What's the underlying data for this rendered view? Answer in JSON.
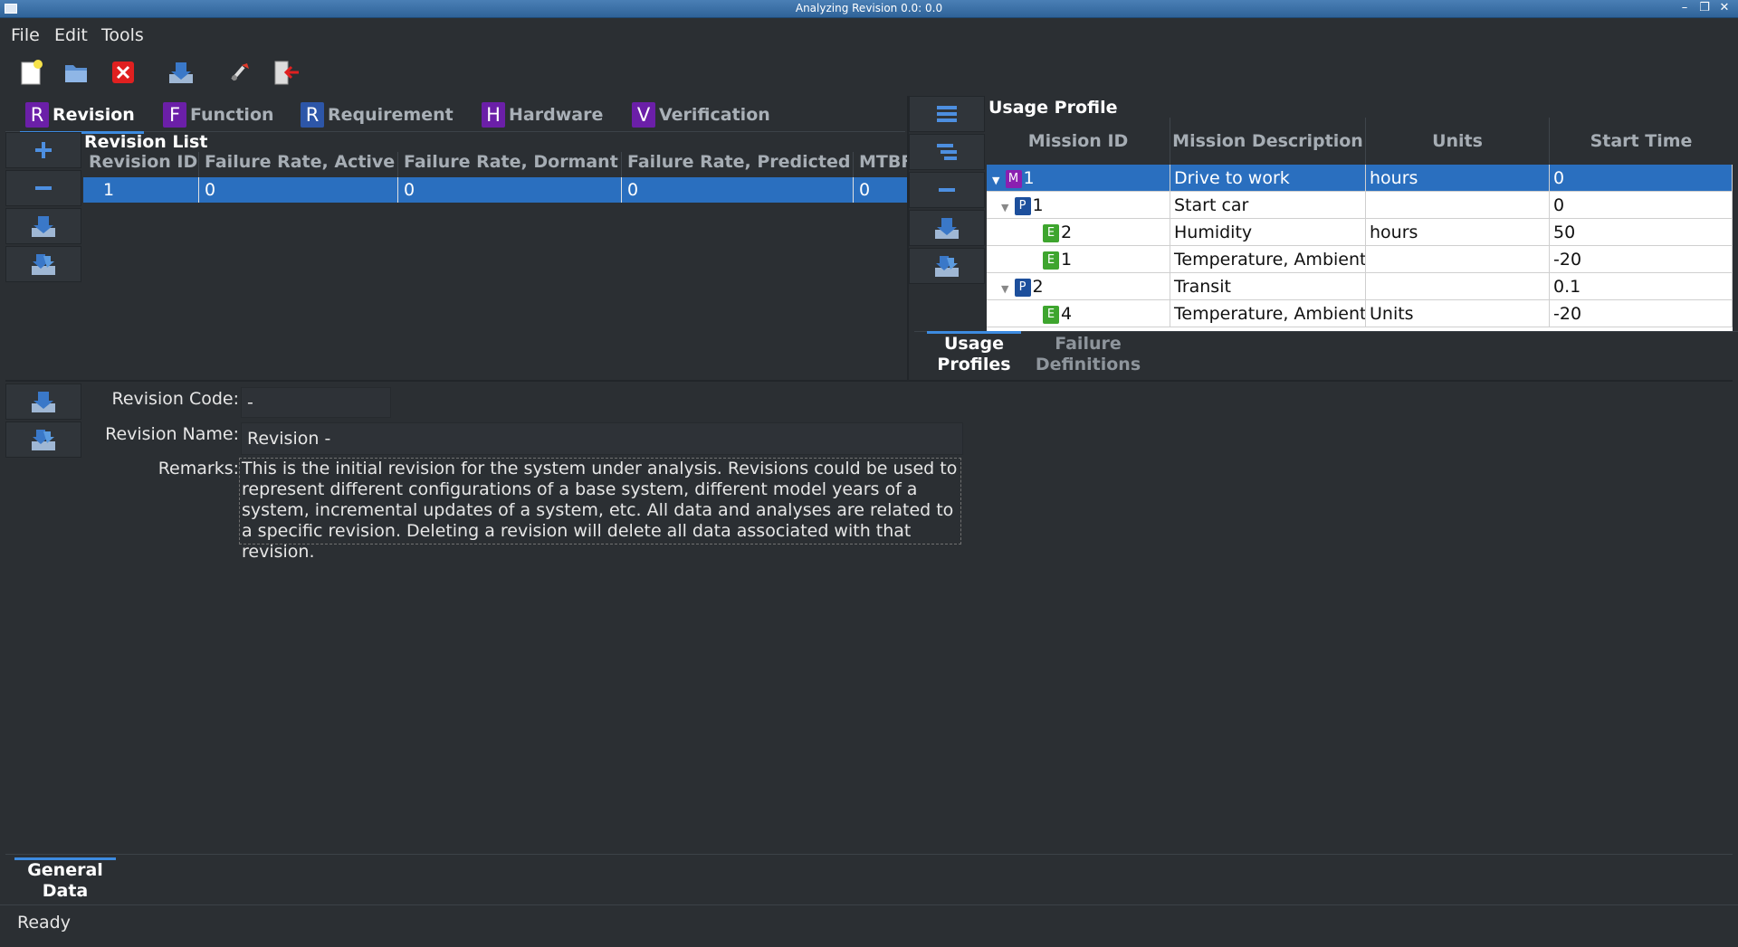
{
  "window": {
    "title": "Analyzing Revision 0.0: 0.0"
  },
  "menu": {
    "file": "File",
    "edit": "Edit",
    "tools": "Tools"
  },
  "workbook_tabs": [
    {
      "letter": "R",
      "label": "Revision",
      "color": "#6b1fa8"
    },
    {
      "letter": "F",
      "label": "Function",
      "color": "#6b1fa8"
    },
    {
      "letter": "R",
      "label": "Requirement",
      "color": "#2d56a8"
    },
    {
      "letter": "H",
      "label": "Hardware",
      "color": "#6b1fa8"
    },
    {
      "letter": "V",
      "label": "Verification",
      "color": "#6b1fa8"
    }
  ],
  "revision_list": {
    "title": "Revision List",
    "columns": [
      "Revision ID",
      "Failure Rate, Active",
      "Failure Rate, Dormant",
      "Failure Rate, Predicted",
      "MTBF"
    ],
    "rows": [
      [
        "1",
        "0",
        "0",
        "0",
        "0"
      ]
    ]
  },
  "usage_profile": {
    "title": "Usage Profile",
    "columns": [
      "Mission ID",
      "Mission Description",
      "Units",
      "Start Time"
    ],
    "rows": [
      {
        "badge": "M",
        "id": "1",
        "desc": "Drive to work",
        "units": "hours",
        "start": "0"
      },
      {
        "badge": "P",
        "id": "1",
        "desc": "Start car",
        "units": "",
        "start": "0"
      },
      {
        "badge": "E",
        "id": "2",
        "desc": "Humidity",
        "units": "hours",
        "start": "50"
      },
      {
        "badge": "E",
        "id": "1",
        "desc": "Temperature, Ambient",
        "units": "",
        "start": "-20"
      },
      {
        "badge": "P",
        "id": "2",
        "desc": "Transit",
        "units": "",
        "start": "0.1"
      },
      {
        "badge": "E",
        "id": "4",
        "desc": "Temperature, Ambient",
        "units": "Units",
        "start": "-20"
      }
    ],
    "badge_colors": {
      "M": "#8a1fb0",
      "P": "#1d4f9c",
      "E": "#3ea52e"
    }
  },
  "usage_tabs": {
    "profiles": "Usage Profiles",
    "failure_definitions": "Failure Definitions"
  },
  "general_data": {
    "revision_code_label": "Revision Code:",
    "revision_code_value": "-",
    "revision_name_label": "Revision Name:",
    "revision_name_value": "Revision -",
    "remarks_label": "Remarks:",
    "remarks_value": "This is the initial revision for the system under analysis.  Revisions could be used to represent different configurations of a base system, different model years of a system, incremental updates of a system, etc.  All data and analyses are related to a specific revision.  Deleting a revision will delete all data associated with that revision."
  },
  "bottom_tab": "General Data",
  "status": "Ready"
}
